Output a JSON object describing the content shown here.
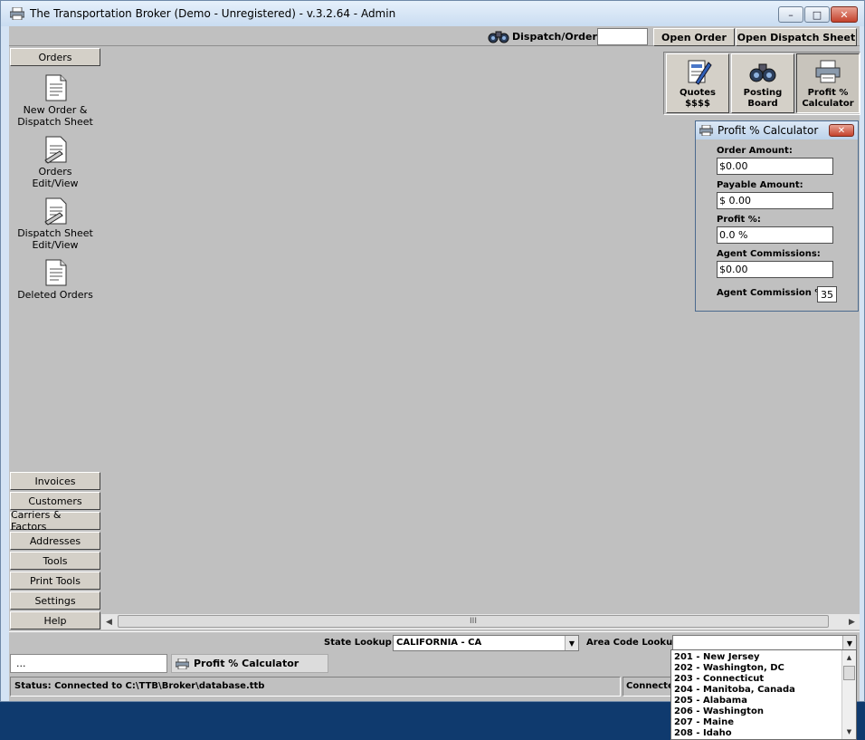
{
  "window": {
    "title": "The Transportation Broker (Demo - Unregistered) - v.3.2.64 - Admin",
    "minimize_label": "–",
    "maximize_label": "□",
    "close_label": "✕"
  },
  "toolbar": {
    "dispatch_label": "Dispatch/Order #:",
    "dispatch_value": "",
    "open_order": "Open Order",
    "open_dispatch_sheet": "Open Dispatch Sheet"
  },
  "sidebar": {
    "section": "Orders",
    "items": [
      {
        "line1": "New Order &",
        "line2": "Dispatch Sheet"
      },
      {
        "line1": "Orders",
        "line2": "Edit/View"
      },
      {
        "line1": "Dispatch Sheet",
        "line2": "Edit/View"
      },
      {
        "line1": "Deleted Orders",
        "line2": ""
      }
    ],
    "bottom_buttons": [
      "Invoices",
      "Customers",
      "Carriers & Factors",
      "Addresses",
      "Tools",
      "Print Tools",
      "Settings",
      "Help"
    ]
  },
  "quick": {
    "quotes": {
      "line1": "Quotes",
      "line2": "$$$$"
    },
    "posting": {
      "line1": "Posting",
      "line2": "Board"
    },
    "profit": {
      "line1": "Profit %",
      "line2": "Calculator"
    }
  },
  "calculator": {
    "title": "Profit % Calculator",
    "close_label": "✕",
    "order_amount_label": "Order Amount:",
    "order_amount": "$0.00",
    "payable_amount_label": "Payable Amount:",
    "payable_amount": "$ 0.00",
    "profit_label": "Profit %:",
    "profit": "0.0 %",
    "agent_commissions_label": "Agent Commissions:",
    "agent_commissions": "$0.00",
    "agent_commission_pct_label": "Agent Commission %:",
    "agent_commission_pct": "35"
  },
  "hscroll": {
    "grip": "III",
    "left": "◀",
    "right": "▶"
  },
  "lookup": {
    "state_label": "State Lookup:",
    "state_value": "CALIFORNIA - CA",
    "area_label": "Area Code Lookup:",
    "area_value": "",
    "arrow": "▼",
    "area_codes": [
      "201 - New Jersey",
      "202 - Washington, DC",
      "203 - Connecticut",
      "204 - Manitoba, Canada",
      "205 - Alabama",
      "206 - Washington",
      "207 - Maine",
      "208 - Idaho"
    ]
  },
  "taskbar": {
    "dots": "...",
    "open_window": "Profit % Calculator"
  },
  "status": {
    "main": "Status: Connected to C:\\TTB\\Broker\\database.ttb",
    "side": "Connected"
  }
}
